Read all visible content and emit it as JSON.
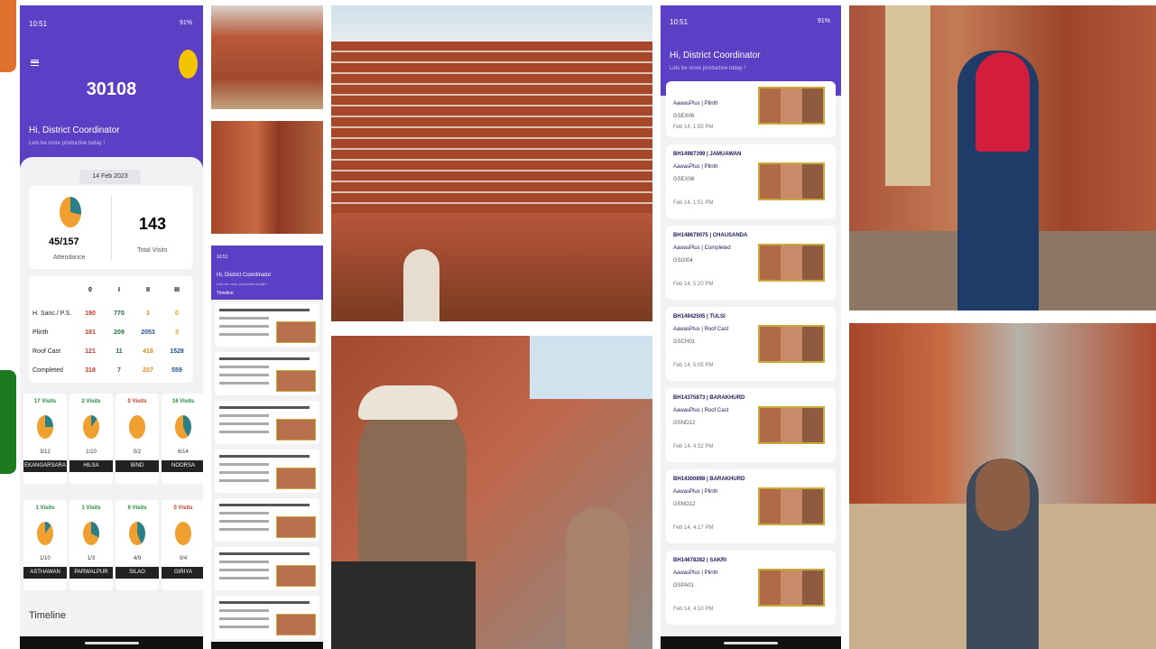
{
  "phone1": {
    "status_time": "10:51",
    "status_battery": "91%",
    "menu_icon": "hamburger-icon",
    "big_number": "30108",
    "greeting": "Hi, District Coordinator",
    "subtitle": "Lets be more productive today !",
    "date": "14 Feb 2023",
    "attendance_value": "45/157",
    "attendance_label": "Attendance",
    "attendance_fraction": 0.29,
    "total_visits_value": "143",
    "total_visits_label": "Total Visits",
    "table_headers": [
      "0",
      "I",
      "II",
      "III"
    ],
    "table_rows": [
      {
        "label": "H. Sanc./ P.S.",
        "values": [
          "190",
          "770",
          "3",
          "0"
        ]
      },
      {
        "label": "Plinth",
        "values": [
          "181",
          "209",
          "2053",
          "3"
        ]
      },
      {
        "label": "Roof Cast",
        "values": [
          "121",
          "11",
          "418",
          "1528"
        ]
      },
      {
        "label": "Completed",
        "values": [
          "318",
          "7",
          "207",
          "559"
        ]
      }
    ],
    "districts_row1": [
      {
        "visits": "17 Visits",
        "ratio": "3/12",
        "name": "EKANGARSARA",
        "fraction": 0.25
      },
      {
        "visits": "2 Visits",
        "ratio": "1/10",
        "name": "HILSA",
        "fraction": 0.1
      },
      {
        "visits": "0 Visits",
        "ratio": "0/2",
        "name": "BIND",
        "fraction": 0.0
      },
      {
        "visits": "16 Visits",
        "ratio": "6/14",
        "name": "NOORSA",
        "fraction": 0.43
      }
    ],
    "districts_row2": [
      {
        "visits": "1 Visits",
        "ratio": "1/10",
        "name": "ASTHAWAN",
        "fraction": 0.1
      },
      {
        "visits": "1 Visits",
        "ratio": "1/3",
        "name": "PARWALPUR",
        "fraction": 0.33
      },
      {
        "visits": "9 Visits",
        "ratio": "4/9",
        "name": "SILAO",
        "fraction": 0.44
      },
      {
        "visits": "0 Visits",
        "ratio": "0/4",
        "name": "GIRIYA",
        "fraction": 0.0
      }
    ],
    "timeline_label": "Timeline"
  },
  "phone2": {
    "status_time": "10:51",
    "greeting": "Hi, District Coordinator",
    "subtitle": "Lets be more productive today !",
    "section": "Timeline"
  },
  "phone3": {
    "status_time": "10:51",
    "status_battery": "91%",
    "greeting": "Hi, District Coordinator",
    "subtitle": "Lets be more productive today !",
    "items": [
      {
        "title": "",
        "line2": "AawasPlus | Plinth",
        "code": "GSEX06",
        "time": "Feb 14, 1:55 PM"
      },
      {
        "title": "BH14987399 | JAMUAWAN",
        "line2": "AawasPlus | Plinth",
        "code": "GSEX06",
        "time": "Feb 14, 1:51 PM"
      },
      {
        "title": "BH148679075 | CHAUSANDA",
        "line2": "AawasPlus | Completed",
        "code": "GSGI04",
        "time": "Feb 14, 5:20 PM"
      },
      {
        "title": "BH14942505 | TULSI",
        "line2": "AawasPlus | Roof Cast",
        "code": "GSCH01",
        "time": "Feb 14, 5:05 PM"
      },
      {
        "title": "BH14375873 | BARAKHURD",
        "line2": "AawasPlus | Roof Cast",
        "code": "GSNO12",
        "time": "Feb 14, 4:32 PM"
      },
      {
        "title": "BH14300898 | BARAKHURD",
        "line2": "AawasPlus | Plinth",
        "code": "GSNO12",
        "time": "Feb 14, 4:17 PM"
      },
      {
        "title": "BH14678282 | SAKRI",
        "line2": "AawasPlus | Plinth",
        "code": "GSPA01",
        "time": "Feb 14, 4:10 PM"
      }
    ]
  },
  "colors": {
    "purple": "#5b3fc4",
    "brick": "#b5532f",
    "accent_orange": "#f0a030",
    "accent_teal": "#2b7f86",
    "sun_yellow": "#f5c400",
    "dark_green": "#1e7a1e",
    "orange_tab": "#e0702e"
  }
}
